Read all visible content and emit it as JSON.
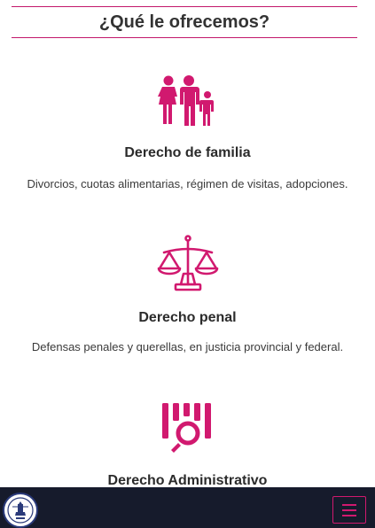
{
  "header": {
    "title": "¿Qué le ofrecemos?"
  },
  "services": [
    {
      "title": "Derecho de familia",
      "description": "Divorcios, cuotas alimentarias, régimen de visitas, adopciones.",
      "icon": "family-icon"
    },
    {
      "title": "Derecho penal",
      "description": "Defensas penales y querellas, en justicia provincial y federal.",
      "icon": "scales-of-justice-icon"
    },
    {
      "title": "Derecho Administrativo",
      "description": "",
      "icon": "document-search-icon"
    }
  ],
  "navbar": {
    "logo": "law-firm-logo",
    "menu_icon": "hamburger-menu-icon"
  },
  "colors": {
    "accent": "#d1196f",
    "navbar": "#161b2c",
    "text": "#2b2b2b"
  }
}
